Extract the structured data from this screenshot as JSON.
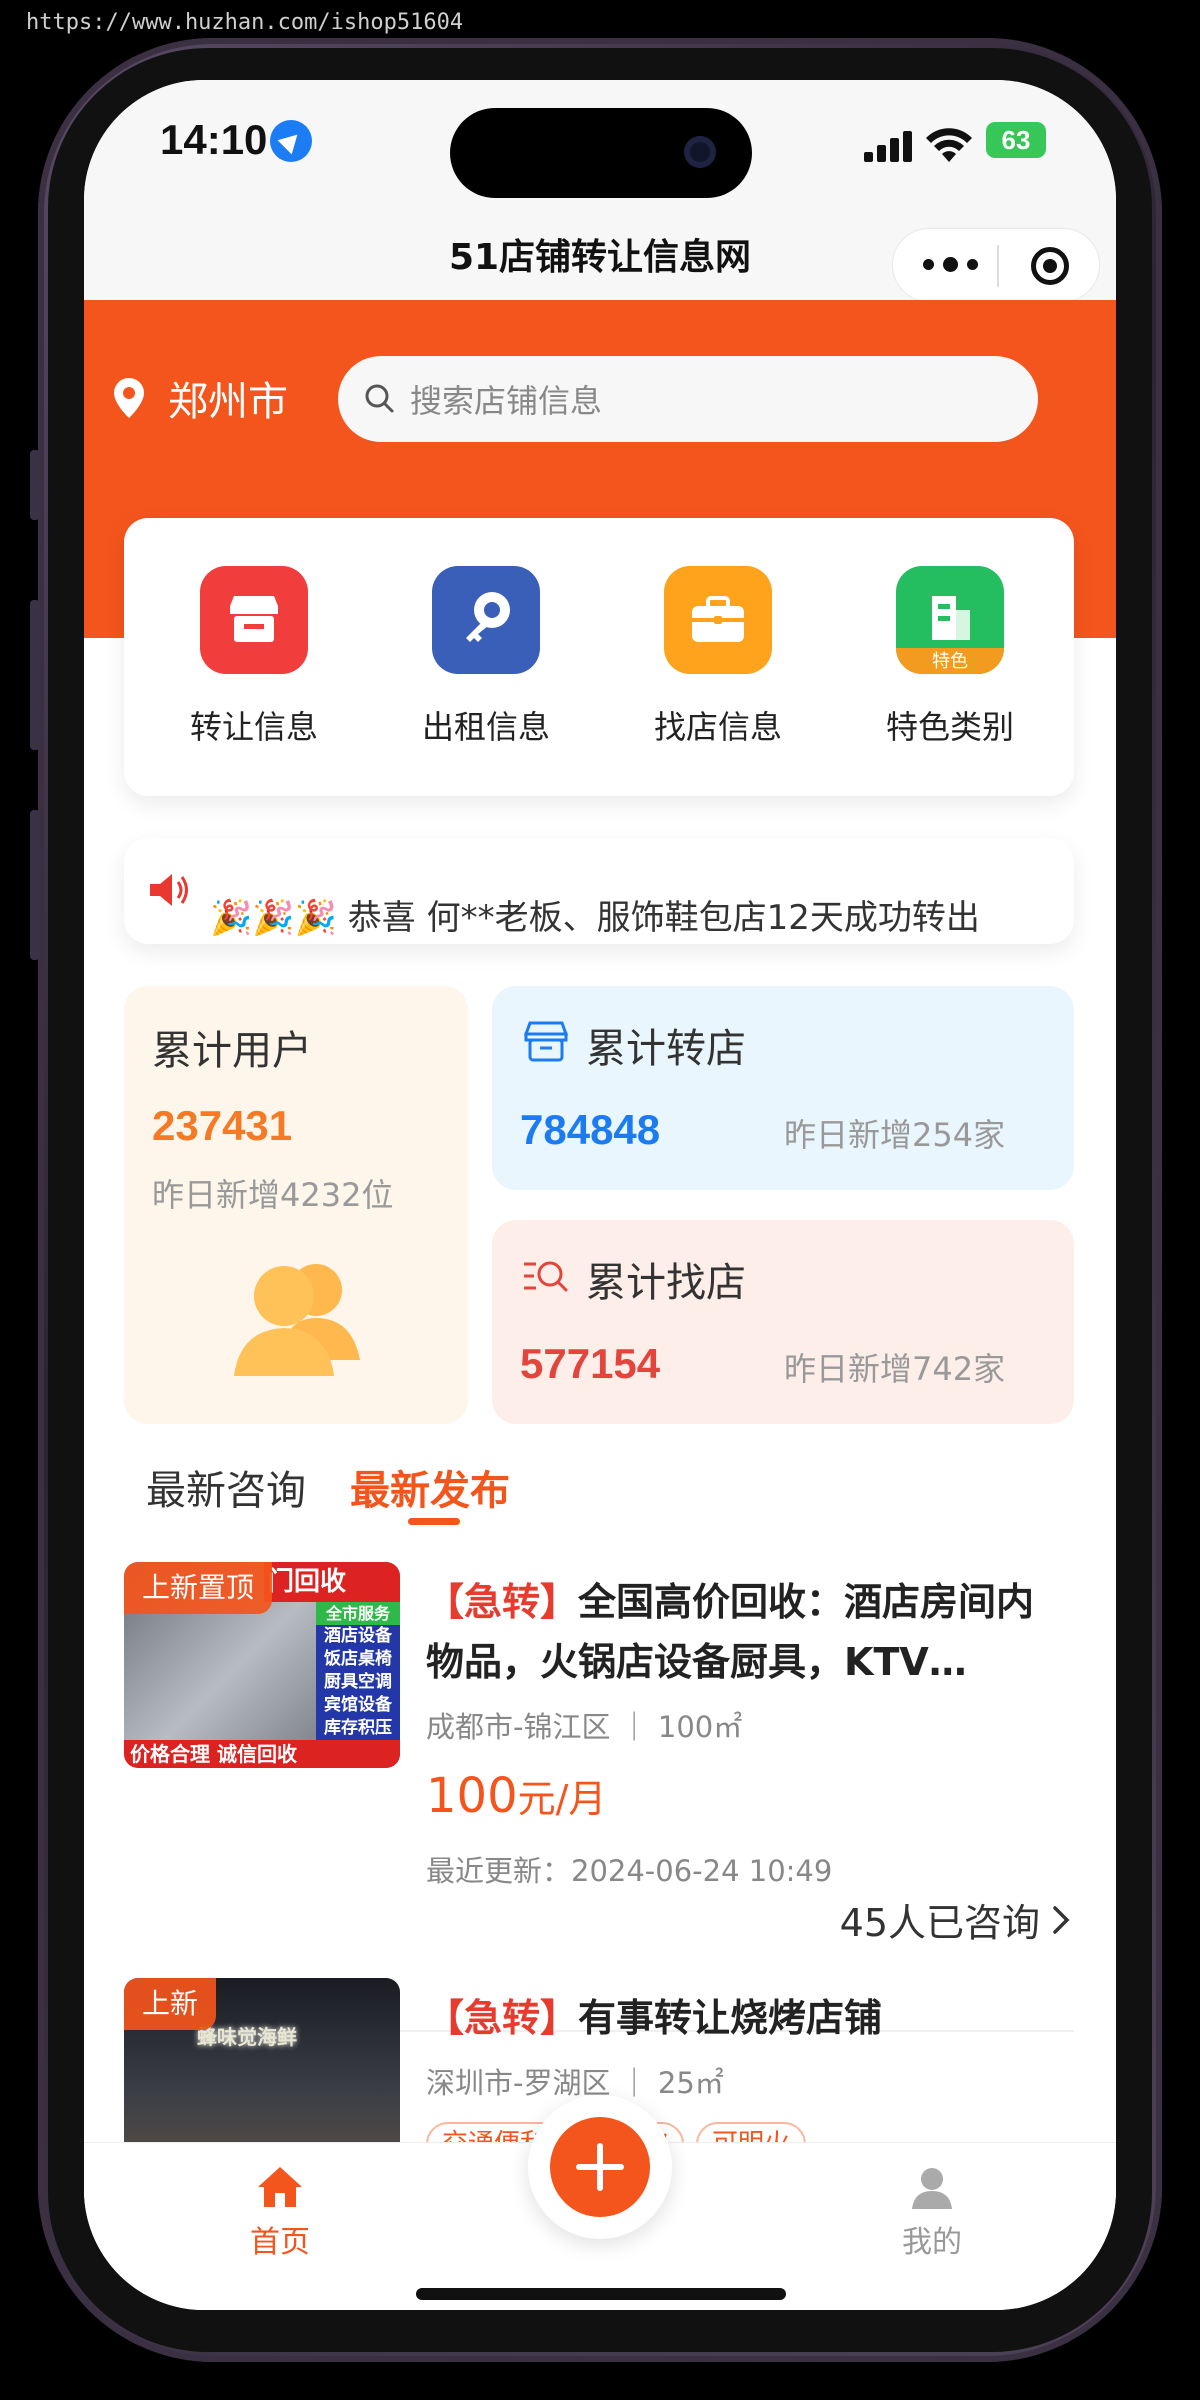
{
  "watermark": "https://www.huzhan.com/ishop51604",
  "status_bar": {
    "time": "14:10",
    "battery": "63"
  },
  "titlebar": {
    "title": "51店铺转让信息网"
  },
  "header": {
    "city": "郑州市",
    "search_placeholder": "搜索店铺信息"
  },
  "menu": [
    {
      "label": "转让信息",
      "icon": "store-icon",
      "color": "#f23d3d"
    },
    {
      "label": "出租信息",
      "icon": "key-icon",
      "color": "#3a5fb8"
    },
    {
      "label": "找店信息",
      "icon": "briefcase-icon",
      "color": "#ffa21c"
    },
    {
      "label": "特色类别",
      "icon": "building-icon",
      "color": "#24bd5f",
      "badge": "特色"
    }
  ],
  "notice": {
    "text": "🎉🎉🎉 恭喜 何**老板、服饰鞋包店12天成功转出"
  },
  "stats": {
    "users": {
      "title": "累计用户",
      "number": "237431",
      "sub": "昨日新增4232位",
      "color": "#f47a26"
    },
    "transfer": {
      "title": "累计转店",
      "number": "784848",
      "sub": "昨日新增254家",
      "color": "#1a7cf0"
    },
    "find": {
      "title": "累计找店",
      "number": "577154",
      "sub": "昨日新增742家",
      "color": "#e2453c"
    }
  },
  "tabs": [
    {
      "label": "最新咨询"
    },
    {
      "label": "最新发布"
    }
  ],
  "listings": [
    {
      "badge": "上新置顶",
      "tag": "【急转】",
      "title": "全国高价回收：酒店房间内物品，火锅店设备厨具，KTV…",
      "location": "成都市-锦江区 ｜ 100㎡",
      "price": "100",
      "price_unit": "元/月",
      "updated": "最近更新：2024-06-24 10:49",
      "consult": "45人已咨询",
      "thumb_texts": [
        "门回收",
        "全市服务",
        "酒店设备",
        "饭店桌椅",
        "厨具空调",
        "宾馆设备",
        "库存积压",
        "价格合理 诚信回收"
      ]
    },
    {
      "badge": "上新",
      "tag": "【急转】",
      "title": "有事转让烧烤店铺",
      "location": "深圳市-罗湖区 ｜ 25㎡",
      "tags": [
        "交通便利",
        "可餐饮",
        "可明火"
      ],
      "thumb_texts": [
        "蜂味觉海鲜"
      ]
    }
  ],
  "nav": [
    {
      "label": "首页"
    },
    {
      "label": "我的"
    }
  ]
}
